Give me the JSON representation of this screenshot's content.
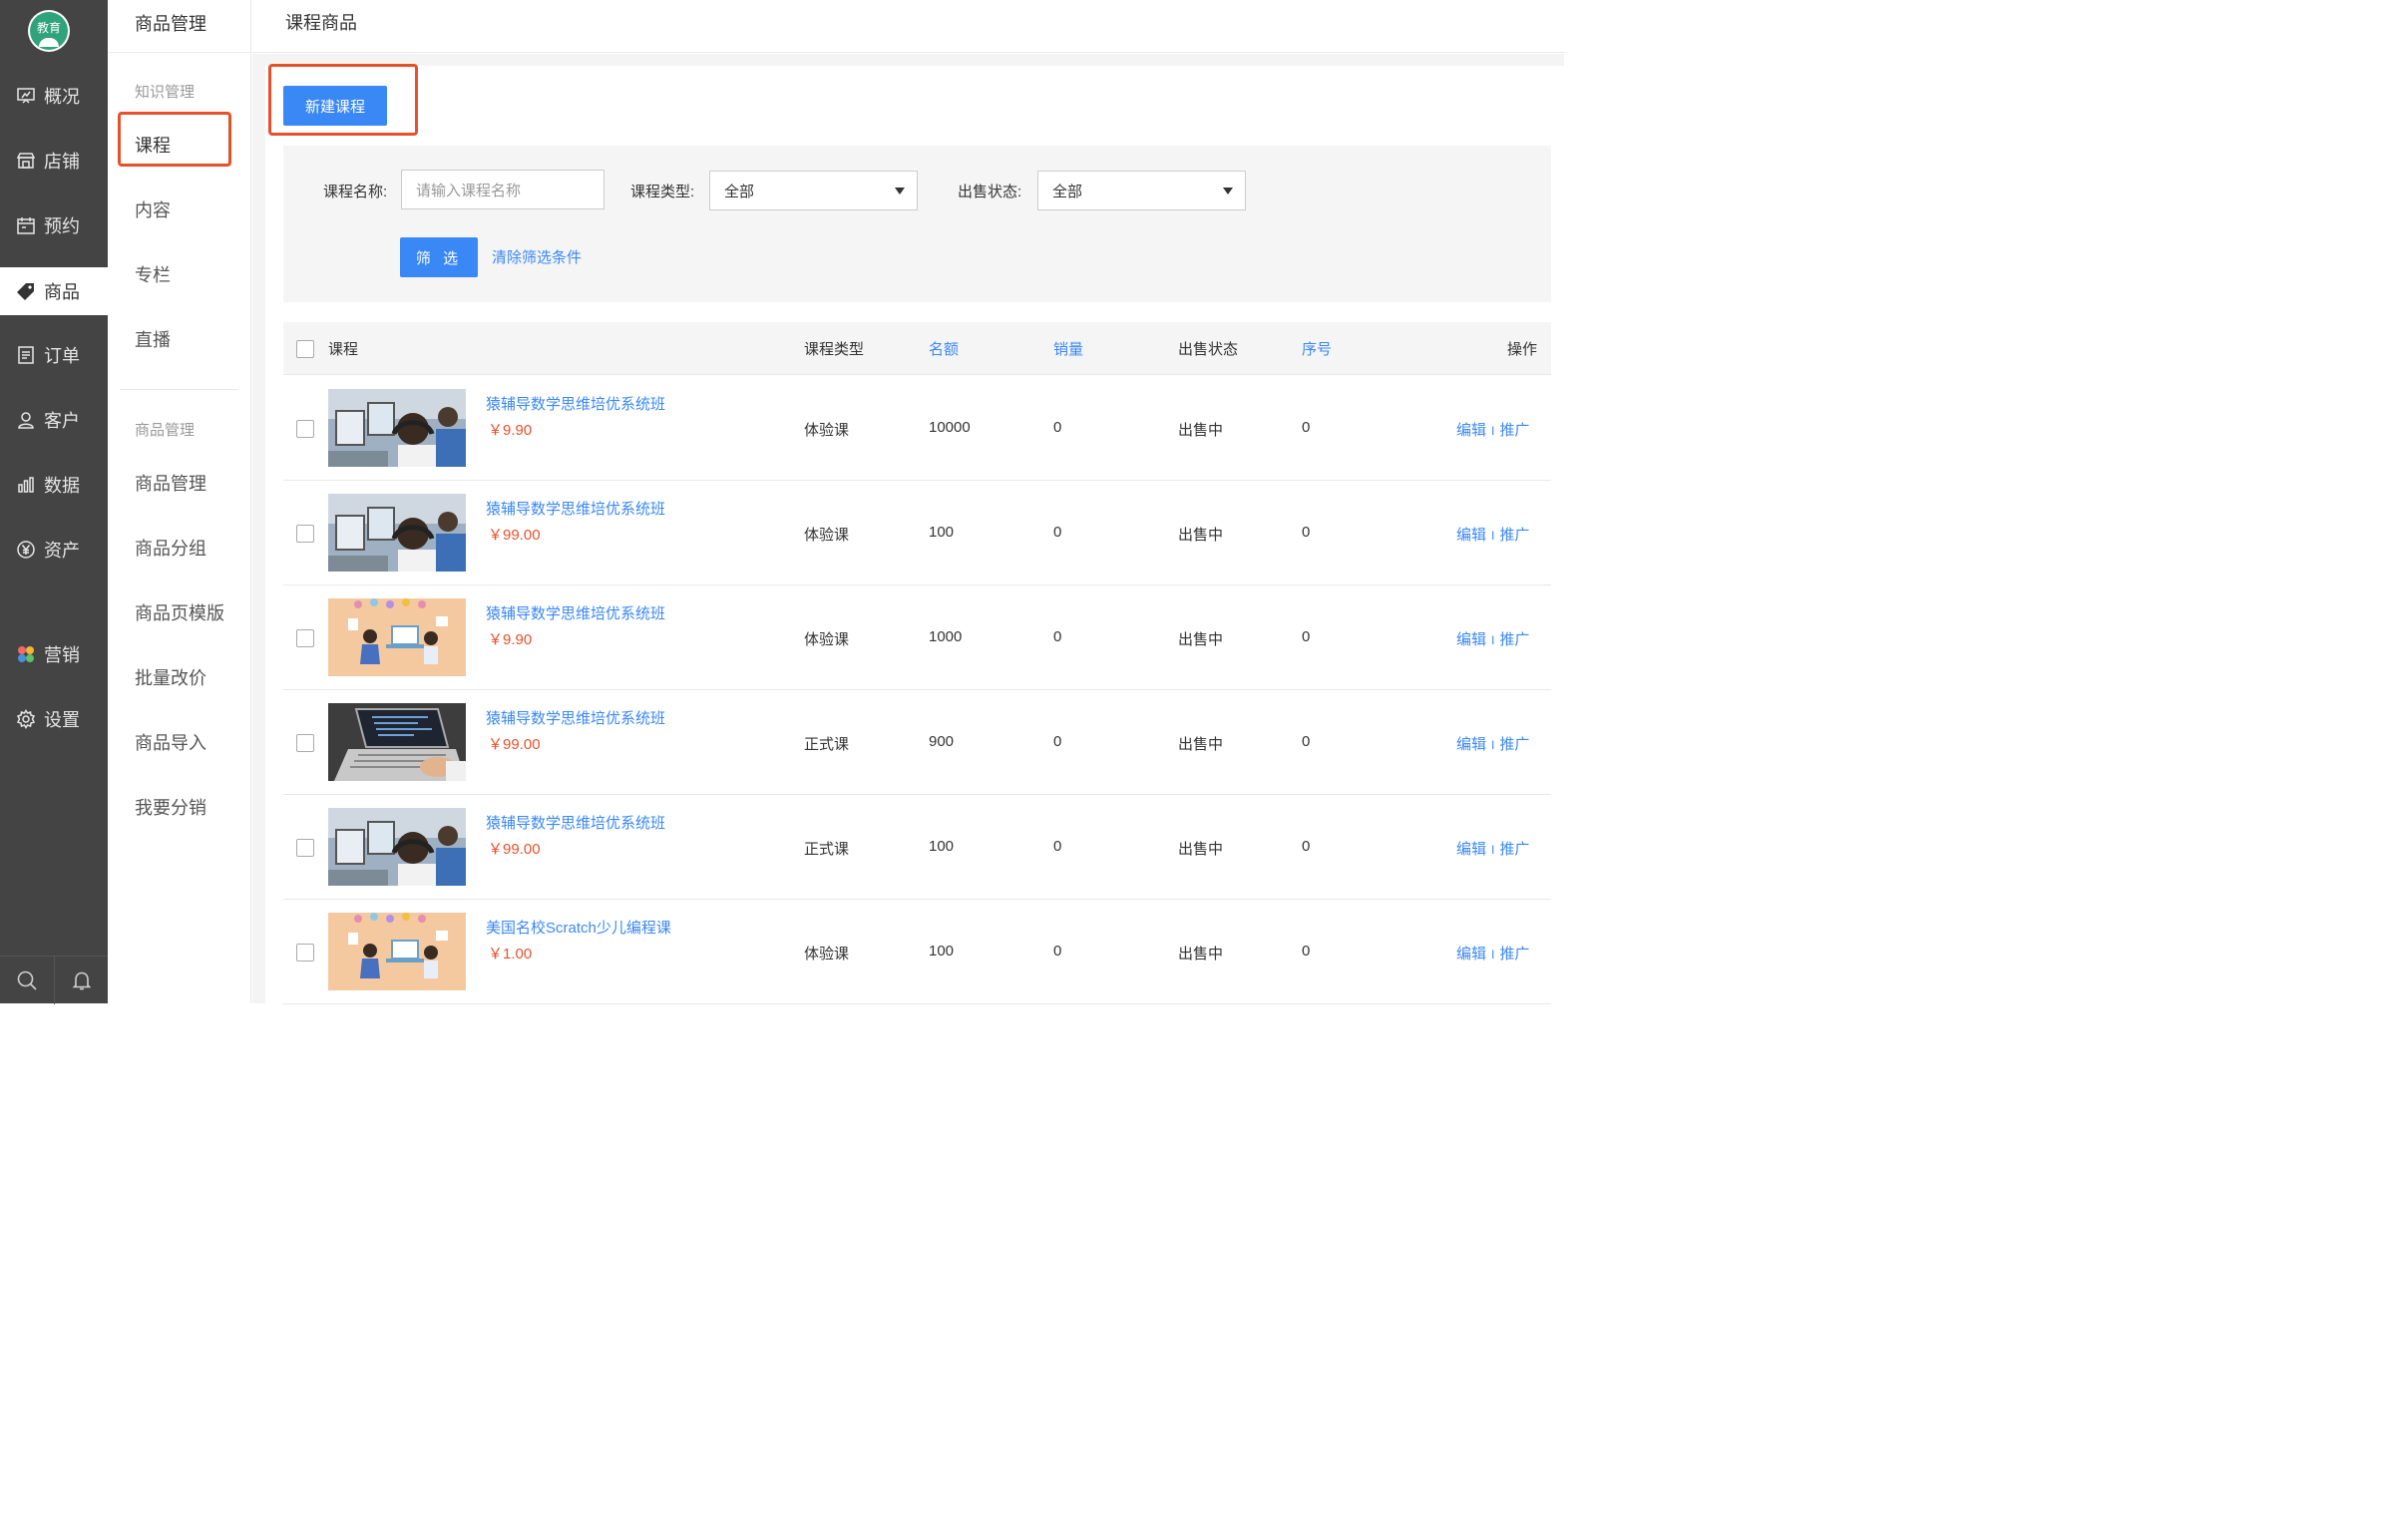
{
  "logo": {
    "text": "教育"
  },
  "left_nav": [
    {
      "label": "概况",
      "icon": "presentation-icon",
      "active": false
    },
    {
      "label": "店铺",
      "icon": "store-icon",
      "active": false
    },
    {
      "label": "预约",
      "icon": "calendar-icon",
      "active": false
    },
    {
      "label": "商品",
      "icon": "tag-icon",
      "active": true
    },
    {
      "label": "订单",
      "icon": "document-icon",
      "active": false
    },
    {
      "label": "客户",
      "icon": "user-icon",
      "active": false
    },
    {
      "label": "数据",
      "icon": "bar-chart-icon",
      "active": false
    },
    {
      "label": "资产",
      "icon": "yen-circle-icon",
      "active": false
    },
    {
      "label": "营销",
      "icon": "clover-icon",
      "active": false
    },
    {
      "label": "设置",
      "icon": "gear-icon",
      "active": false
    }
  ],
  "left_nav_bottom": [
    "search-icon",
    "bell-icon"
  ],
  "sub_nav": {
    "title": "商品管理",
    "groups": [
      {
        "title": "知识管理",
        "items": [
          "课程",
          "内容",
          "专栏",
          "直播"
        ]
      },
      {
        "title": "商品管理",
        "items": [
          "商品管理",
          "商品分组",
          "商品页模版",
          "批量改价",
          "商品导入",
          "我要分销"
        ]
      }
    ],
    "active_item": "课程"
  },
  "page": {
    "title": "课程商品"
  },
  "toolbar": {
    "new_button": "新建课程"
  },
  "filter": {
    "name_label": "课程名称:",
    "name_placeholder": "请输入课程名称",
    "type_label": "课程类型:",
    "type_value": "全部",
    "status_label": "出售状态:",
    "status_value": "全部",
    "filter_button": "筛 选",
    "clear_link": "清除筛选条件"
  },
  "table": {
    "columns": [
      "课程",
      "课程类型",
      "名额",
      "销量",
      "出售状态",
      "序号",
      "操作"
    ],
    "sortable_columns": [
      "名额",
      "销量",
      "序号"
    ],
    "rows": [
      {
        "title": "猿辅导数学思维培优系统班",
        "price": "￥9.90",
        "type": "体验课",
        "quota": "10000",
        "sales": "0",
        "status": "出售中",
        "order": "0",
        "thumb": "classroom"
      },
      {
        "title": "猿辅导数学思维培优系统班",
        "price": "￥99.00",
        "type": "体验课",
        "quota": "100",
        "sales": "0",
        "status": "出售中",
        "order": "0",
        "thumb": "classroom"
      },
      {
        "title": "猿辅导数学思维培优系统班",
        "price": "￥9.90",
        "type": "体验课",
        "quota": "1000",
        "sales": "0",
        "status": "出售中",
        "order": "0",
        "thumb": "cartoon"
      },
      {
        "title": "猿辅导数学思维培优系统班",
        "price": "￥99.00",
        "type": "正式课",
        "quota": "900",
        "sales": "0",
        "status": "出售中",
        "order": "0",
        "thumb": "laptop"
      },
      {
        "title": "猿辅导数学思维培优系统班",
        "price": "￥99.00",
        "type": "正式课",
        "quota": "100",
        "sales": "0",
        "status": "出售中",
        "order": "0",
        "thumb": "classroom"
      },
      {
        "title": "美国名校Scratch少儿编程课",
        "price": "￥1.00",
        "type": "体验课",
        "quota": "100",
        "sales": "0",
        "status": "出售中",
        "order": "0",
        "thumb": "cartoon"
      }
    ],
    "actions": {
      "edit": "编辑",
      "separator": "I",
      "promote": "推广"
    }
  },
  "colors": {
    "nav_bg": "#444444",
    "accent": "#3a88f5",
    "price": "#e8502a",
    "highlight": "#e8502a"
  }
}
